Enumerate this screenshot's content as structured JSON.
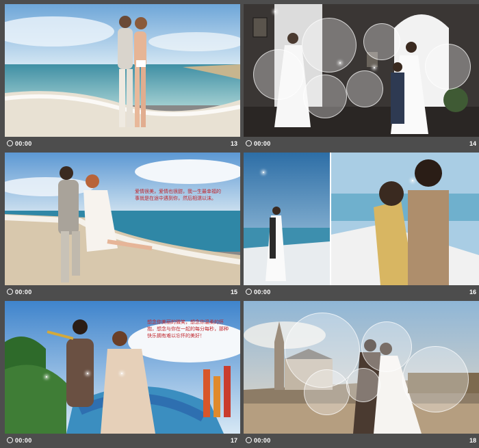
{
  "slides": [
    {
      "number": "13",
      "time": "00:00"
    },
    {
      "number": "14",
      "time": "00:00"
    },
    {
      "number": "15",
      "time": "00:00",
      "caption": "爱情很美，爱情也很甜，我一生最幸福的事就是在途中遇到你，然后相濡以沫。"
    },
    {
      "number": "16",
      "time": "00:00"
    },
    {
      "number": "17",
      "time": "00:00",
      "caption": "想念你美丽的微笑，想念你温柔的怀抱，想念与你在一起的每分每秒，那种快乐拥有难以忘怀的美好！"
    },
    {
      "number": "18",
      "time": "00:00"
    }
  ]
}
